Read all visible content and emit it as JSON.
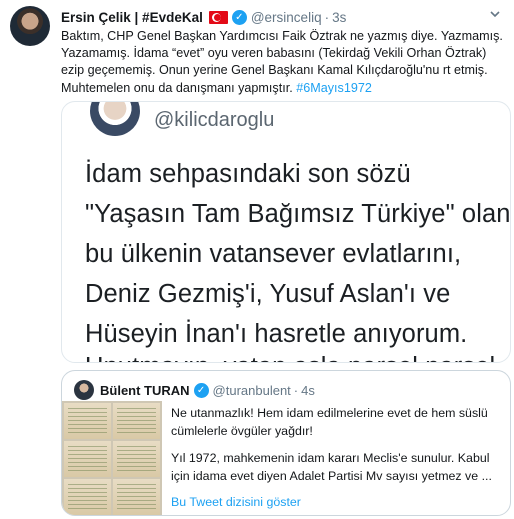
{
  "tweet": {
    "display_name": "Ersin Çelik | #EvdeKal",
    "handle": "@ersinceliq",
    "separator": "·",
    "time": "3s",
    "verified_mark": "✓",
    "text": "Baktım, CHP Genel Başkan Yardımcısı Faik Öztrak ne yazmış diye. Yazmamış. Yazamamış. İdama “evet” oyu veren babasını (Tekirdağ Vekili Orhan Öztrak) ezip geçememiş. Onun yerine Genel Başkanı Kamal Kılıçdaroğlu'nu rt etmiş. Muhtemelen onu da danışmanı yapmıştır. ",
    "hashtag": "#6Mayıs1972",
    "menu_icon": "chevron-down-icon"
  },
  "media": {
    "handle": "@kilicdaroglu",
    "lines": [
      "İdam sehpasındaki son sözü",
      "\"Yaşasın Tam Bağımsız Türkiye\" olan,",
      "bu ülkenin vatansever evlatlarını,",
      "Deniz Gezmiş'i, Yusuf Aslan'ı ve",
      "Hüseyin İnan'ı hasretle anıyorum.",
      "Unutmayın, vatan asla parsel parsel"
    ]
  },
  "quote": {
    "display_name": "Bülent TURAN",
    "verified_mark": "✓",
    "handle": "@turanbulent",
    "separator": "·",
    "time": "4s",
    "paragraph1": "Ne utanmazlık! Hem idam edilmelerine evet de hem süslü cümlelerle övgüler yağdır!",
    "paragraph2": "Yıl 1972, mahkemenin idam kararı Meclis'e sunulur. Kabul için idama evet diyen Adalet Partisi Mv sayısı yetmez ve ...",
    "show_thread": "Bu Tweet dizisini göster"
  },
  "colors": {
    "link": "#1da1f2",
    "muted": "#657786",
    "flag": "#e30a17"
  }
}
